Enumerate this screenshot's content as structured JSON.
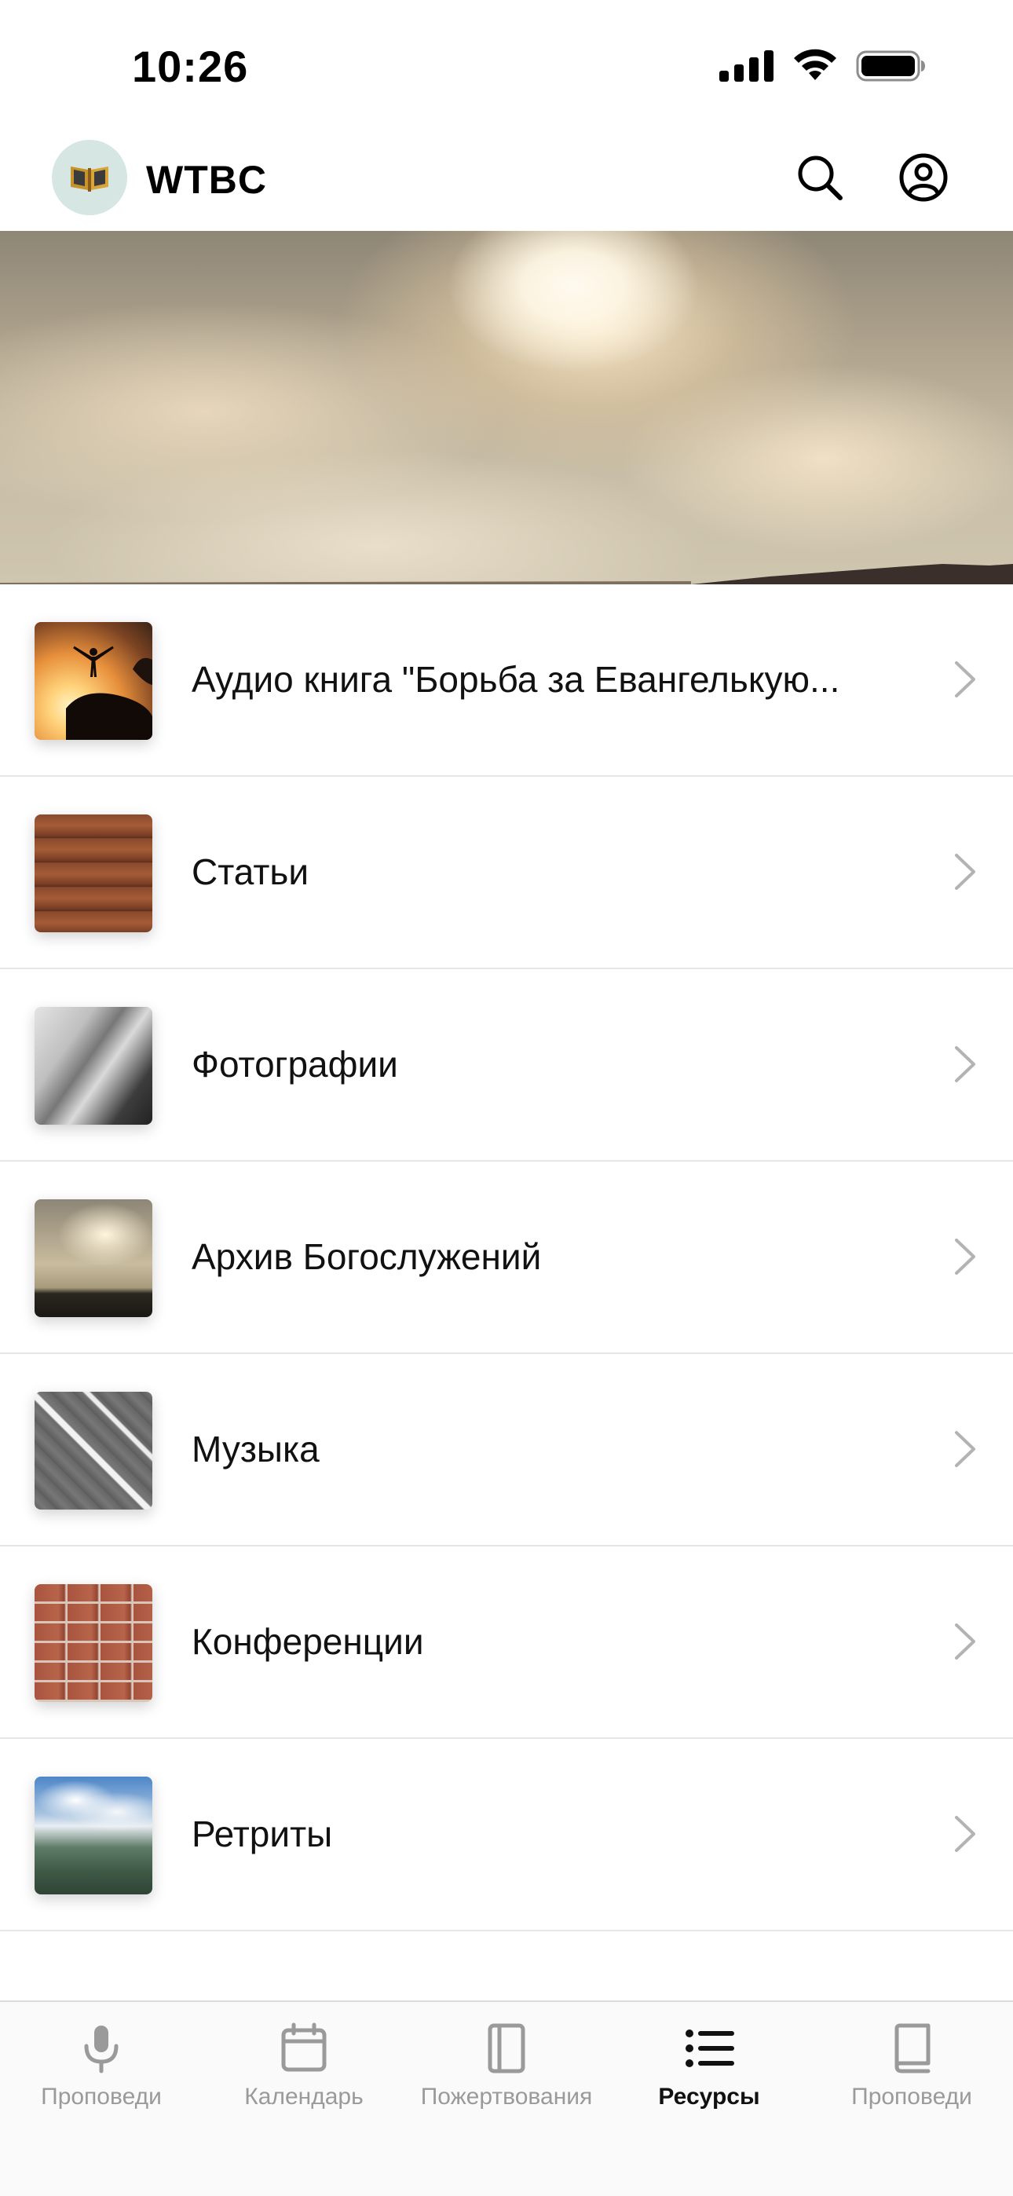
{
  "status_bar": {
    "time": "10:26"
  },
  "header": {
    "app_title": "WTBC"
  },
  "resources": [
    {
      "label": "Аудио книга \"Борьба за Евангелькую..."
    },
    {
      "label": "Статьи"
    },
    {
      "label": "Фотографии"
    },
    {
      "label": "Архив Богослужений"
    },
    {
      "label": "Музыка"
    },
    {
      "label": "Конференции"
    },
    {
      "label": "Ретриты"
    }
  ],
  "tab_bar": {
    "tabs": [
      {
        "label": "Проповеди",
        "icon": "microphone-icon"
      },
      {
        "label": "Календарь",
        "icon": "calendar-icon"
      },
      {
        "label": "Пожертвования",
        "icon": "page-icon"
      },
      {
        "label": "Ресурсы",
        "icon": "list-icon",
        "active": true
      },
      {
        "label": "Проповеди",
        "icon": "book-icon"
      }
    ]
  },
  "colors": {
    "active_tab": "#111111",
    "inactive_tab": "#9a9a9a",
    "divider": "#e6e6e6"
  }
}
